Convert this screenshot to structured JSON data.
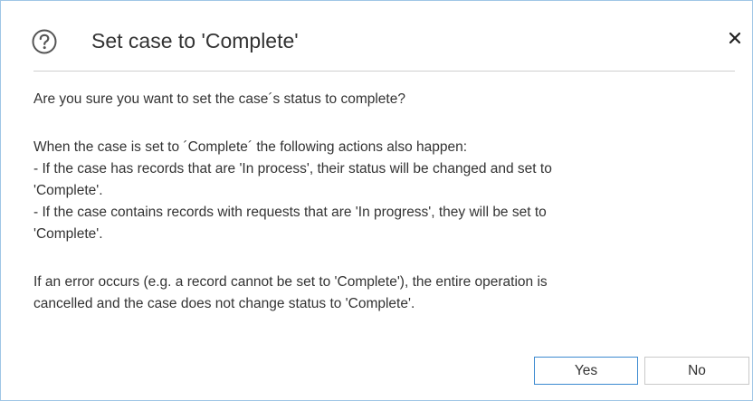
{
  "dialog": {
    "title": "Set case to 'Complete'",
    "icons": {
      "help": "question-circle-icon",
      "close": "close-icon"
    },
    "question": "Are you sure you want to set the case´s status to complete?",
    "details_intro": "When the case is set to ´Complete´ the following actions also happen:",
    "details_line1a": " - If the case has records that are 'In process', their status will be changed and set to",
    "details_line1b": "'Complete'.",
    "details_line2a": " - If the case contains records with requests that are 'In progress', they will be set to",
    "details_line2b": "'Complete'.",
    "error_line1": "If an error occurs (e.g. a record cannot be set to 'Complete'), the entire operation is",
    "error_line2": "cancelled and the case does not change status to 'Complete'.",
    "buttons": {
      "yes": "Yes",
      "no": "No"
    },
    "colors": {
      "border": "#9fc6e6",
      "primary_button_border": "#3c8ad0",
      "text": "#333333"
    }
  }
}
